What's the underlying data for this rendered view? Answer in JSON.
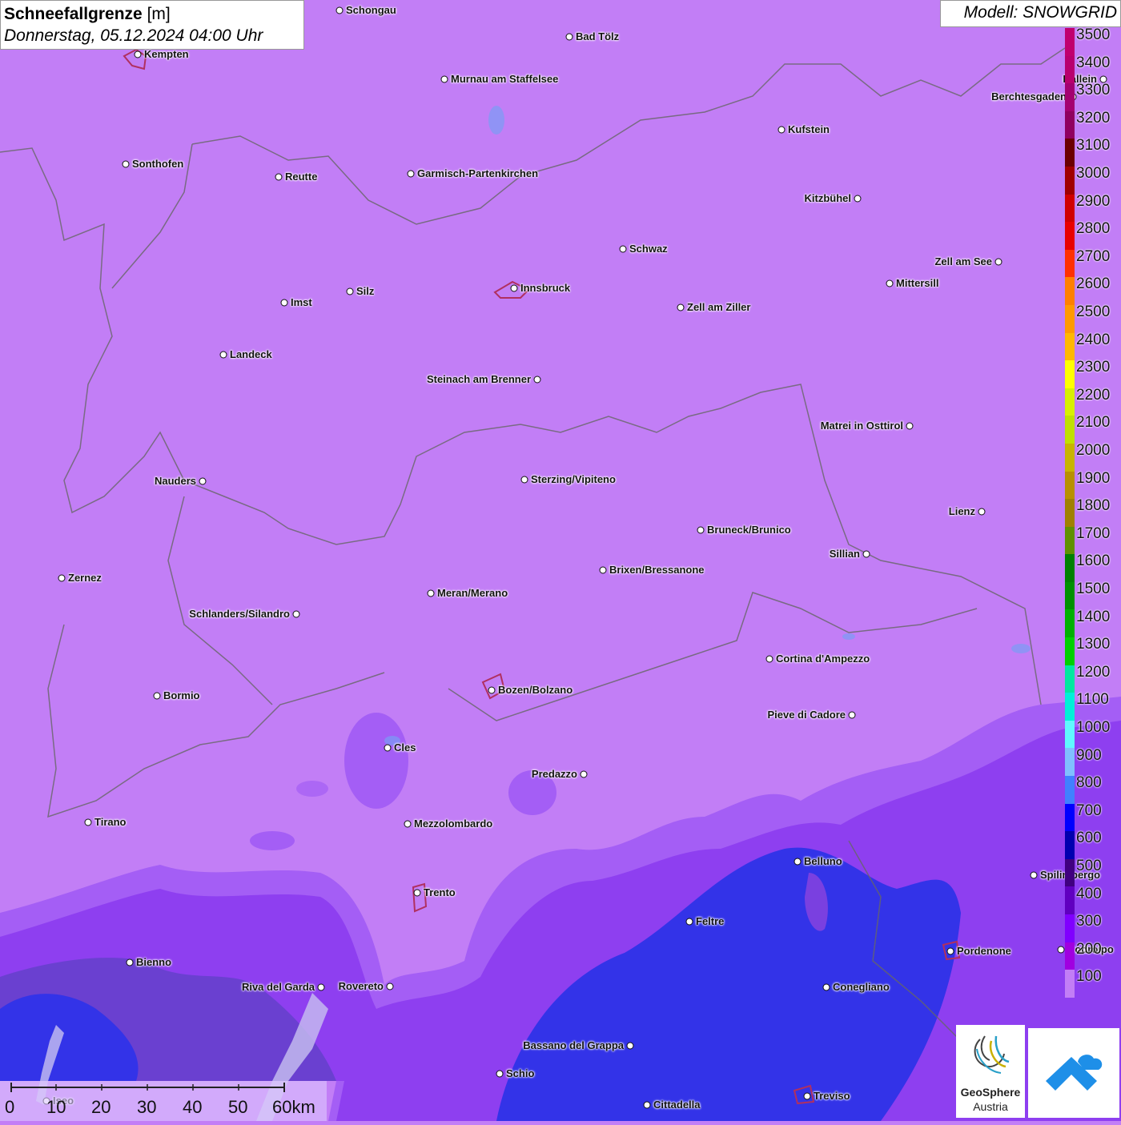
{
  "title": {
    "bold": "Schneefallgrenze",
    "unit": " [m]",
    "subtitle": "Donnerstag, 05.12.2024 04:00 Uhr"
  },
  "model": "Modell: SNOWGRID",
  "legend": {
    "labels": [
      "3500",
      "3400",
      "3300",
      "3200",
      "3100",
      "3000",
      "2900",
      "2800",
      "2700",
      "2600",
      "2500",
      "2400",
      "2300",
      "2200",
      "2100",
      "2000",
      "1900",
      "1800",
      "1700",
      "1600",
      "1500",
      "1400",
      "1300",
      "1200",
      "1100",
      "1000",
      "900",
      "800",
      "700",
      "600",
      "500",
      "400",
      "300",
      "200",
      "100"
    ],
    "colors": [
      "#c0006e",
      "#b8006e",
      "#a40070",
      "#900060",
      "#6b0000",
      "#a00000",
      "#d00000",
      "#e80000",
      "#ff3000",
      "#ff8000",
      "#ff9a00",
      "#ffb800",
      "#ffff00",
      "#d8f000",
      "#c0e000",
      "#c8b400",
      "#b89000",
      "#a08000",
      "#609000",
      "#008000",
      "#009000",
      "#00b000",
      "#00d000",
      "#00e8a0",
      "#00f0d8",
      "#60f8ff",
      "#80c0ff",
      "#4080ff",
      "#0000ff",
      "#0000b0",
      "#400080",
      "#6000c0",
      "#8000ff",
      "#a000e0",
      "#c27ef6"
    ]
  },
  "cities": [
    {
      "name": "Schongau"
    },
    {
      "name": "Bad Tölz"
    },
    {
      "name": "Kempten"
    },
    {
      "name": "Murnau am Staffelsee"
    },
    {
      "name": "Hallein"
    },
    {
      "name": "Berchtesgaden"
    },
    {
      "name": "Kufstein"
    },
    {
      "name": "Sonthofen"
    },
    {
      "name": "Reutte"
    },
    {
      "name": "Garmisch-Partenkirchen"
    },
    {
      "name": "Kitzbühel"
    },
    {
      "name": "Schwaz"
    },
    {
      "name": "Zell am See"
    },
    {
      "name": "Innsbruck"
    },
    {
      "name": "Mittersill"
    },
    {
      "name": "Imst"
    },
    {
      "name": "Silz"
    },
    {
      "name": "Zell am Ziller"
    },
    {
      "name": "Landeck"
    },
    {
      "name": "Steinach am Brenner"
    },
    {
      "name": "Matrei in Osttirol"
    },
    {
      "name": "Nauders"
    },
    {
      "name": "Sterzing/Vipiteno"
    },
    {
      "name": "Lienz"
    },
    {
      "name": "Bruneck/Brunico"
    },
    {
      "name": "Sillian"
    },
    {
      "name": "Zernez"
    },
    {
      "name": "Brixen/Bressanone"
    },
    {
      "name": "Meran/Merano"
    },
    {
      "name": "Schlanders/Silandro"
    },
    {
      "name": "Cortina d'Ampezzo"
    },
    {
      "name": "Bozen/Bolzano"
    },
    {
      "name": "Bormio"
    },
    {
      "name": "Pieve di Cadore"
    },
    {
      "name": "Cles"
    },
    {
      "name": "Predazzo"
    },
    {
      "name": "Tirano"
    },
    {
      "name": "Mezzolombardo"
    },
    {
      "name": "Belluno"
    },
    {
      "name": "Spilimbergo"
    },
    {
      "name": "Trento"
    },
    {
      "name": "Feltre"
    },
    {
      "name": "Pordenone"
    },
    {
      "name": "Codroipo"
    },
    {
      "name": "Bienno"
    },
    {
      "name": "Riva del Garda"
    },
    {
      "name": "Rovereto"
    },
    {
      "name": "Conegliano"
    },
    {
      "name": "Bassano del Grappa"
    },
    {
      "name": "Schio"
    },
    {
      "name": "Treviso"
    },
    {
      "name": "Cittadella"
    },
    {
      "name": "Iseo"
    }
  ],
  "scale": {
    "ticks": [
      "0",
      "10",
      "20",
      "30",
      "40",
      "50",
      "60km"
    ]
  },
  "logo": {
    "name": "GeoSphere",
    "country": "Austria"
  }
}
